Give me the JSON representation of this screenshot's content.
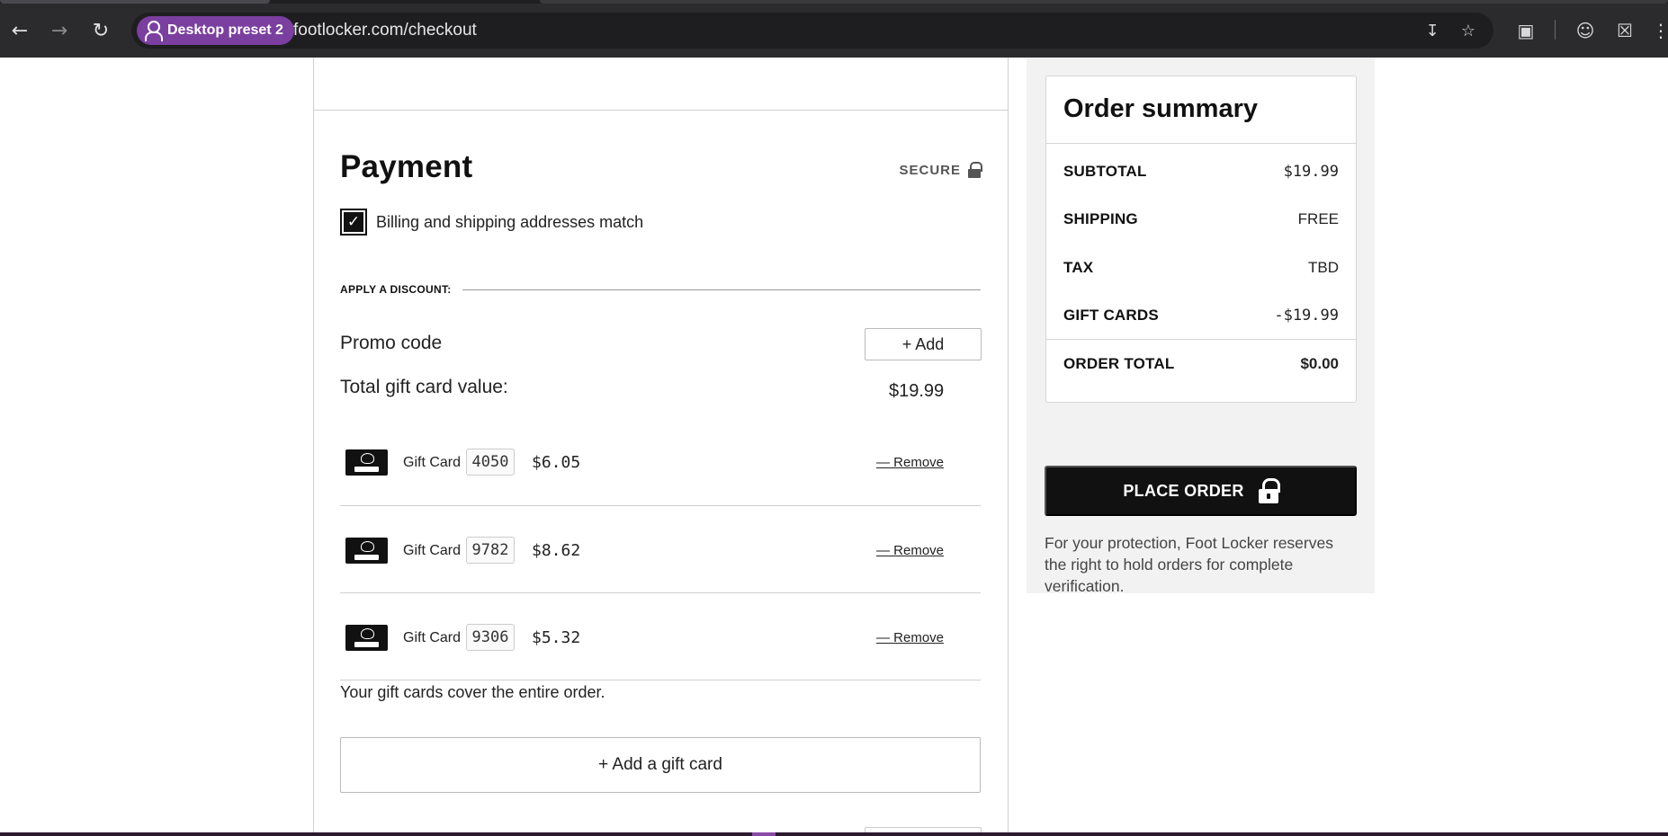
{
  "browser": {
    "profile_label": "Desktop preset 2",
    "url": "footlocker.com/checkout"
  },
  "payment": {
    "title": "Payment",
    "secure_label": "SECURE",
    "billing_match_label": "Billing and shipping addresses match",
    "billing_match_checked": true,
    "discount_heading": "APPLY A DISCOUNT:",
    "promo_label": "Promo code",
    "promo_add_label": "+ Add",
    "gift_total_label": "Total gift card value:",
    "gift_total_value": "$19.99",
    "gift_cards": [
      {
        "name": "Gift Card",
        "last4": "4050",
        "amount": "$6.05",
        "remove_label": "— Remove"
      },
      {
        "name": "Gift Card",
        "last4": "9782",
        "amount": "$8.62",
        "remove_label": "— Remove"
      },
      {
        "name": "Gift Card",
        "last4": "9306",
        "amount": "$5.32",
        "remove_label": "— Remove"
      }
    ],
    "cover_text": "Your gift cards cover the entire order.",
    "add_gift_card_label": "+ Add a gift card"
  },
  "summary": {
    "title": "Order summary",
    "rows": [
      {
        "label": "SUBTOTAL",
        "value": "$19.99"
      },
      {
        "label": "SHIPPING",
        "value": "FREE"
      },
      {
        "label": "TAX",
        "value": "TBD"
      },
      {
        "label": "GIFT CARDS",
        "value": "-$19.99"
      }
    ],
    "total_label": "ORDER TOTAL",
    "total_value": "$0.00",
    "place_order_label": "PLACE ORDER",
    "protection_text": "For your protection, Foot Locker reserves the right to hold orders for complete verification."
  },
  "icons": {
    "back": "arrow-left-icon",
    "forward": "arrow-right-icon",
    "reload": "reload-icon",
    "install": "install-app-icon",
    "bookmark": "star-icon",
    "search_tabs": "search-tabs-icon",
    "account": "account-icon",
    "camera_off": "camera-off-icon",
    "menu": "menu-icon",
    "secure_lock": "lock-icon",
    "gift_card_logo": "foot-locker-logo-icon"
  },
  "colors": {
    "chrome_bg": "#2b2b2e",
    "profile_chip": "#7b3fa0",
    "button_dark": "#111111",
    "summary_panel_bg": "#f2f2f2"
  }
}
